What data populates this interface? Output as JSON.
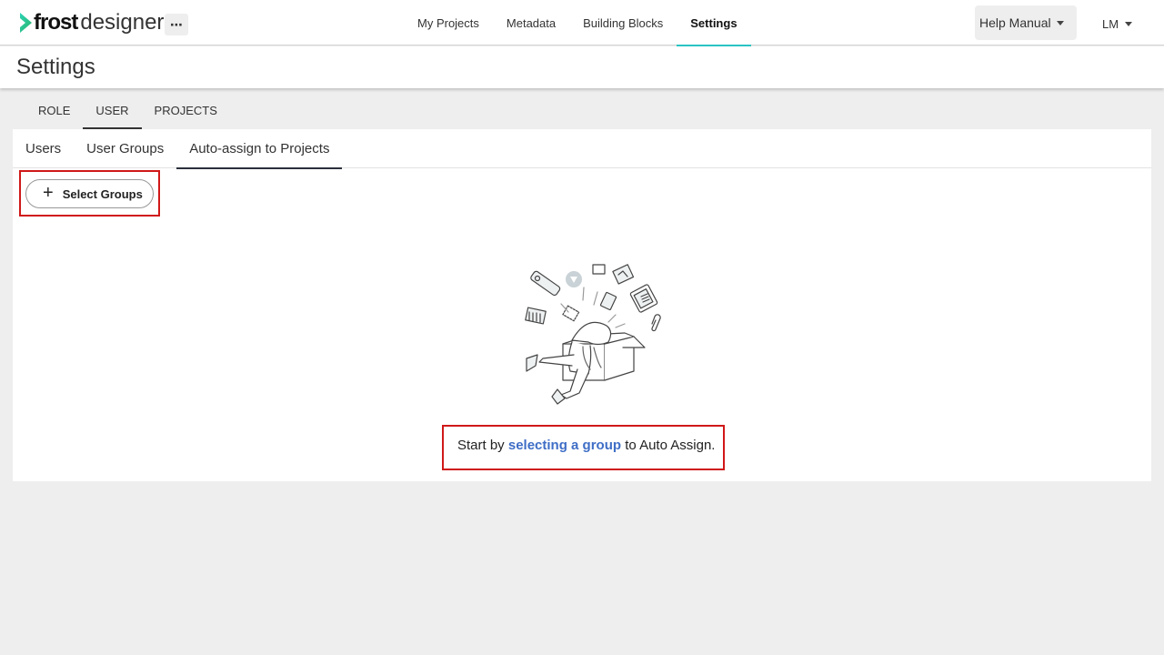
{
  "app": {
    "logo_bold": "frost",
    "logo_light": "designer",
    "more": "⋯"
  },
  "nav": {
    "items": [
      "My Projects",
      "Metadata",
      "Building Blocks",
      "Settings"
    ],
    "active": "Settings"
  },
  "header": {
    "help_label": "Help Manual",
    "user_initials": "LM"
  },
  "page": {
    "title": "Settings"
  },
  "main_tabs": {
    "items": [
      "ROLE",
      "USER",
      "PROJECTS"
    ],
    "active": "USER"
  },
  "sub_tabs": {
    "items": [
      "Users",
      "User Groups",
      "Auto-assign to Projects"
    ],
    "active": "Auto-assign to Projects"
  },
  "actions": {
    "select_groups_label": "Select Groups"
  },
  "empty_state": {
    "prefix": "Start by ",
    "link": "selecting a group",
    "suffix": " to Auto Assign."
  },
  "colors": {
    "accent_teal": "#2bc4c4",
    "link_blue": "#3f6ec6",
    "highlight_red": "#d01818",
    "logo_green": "#29c98f"
  }
}
